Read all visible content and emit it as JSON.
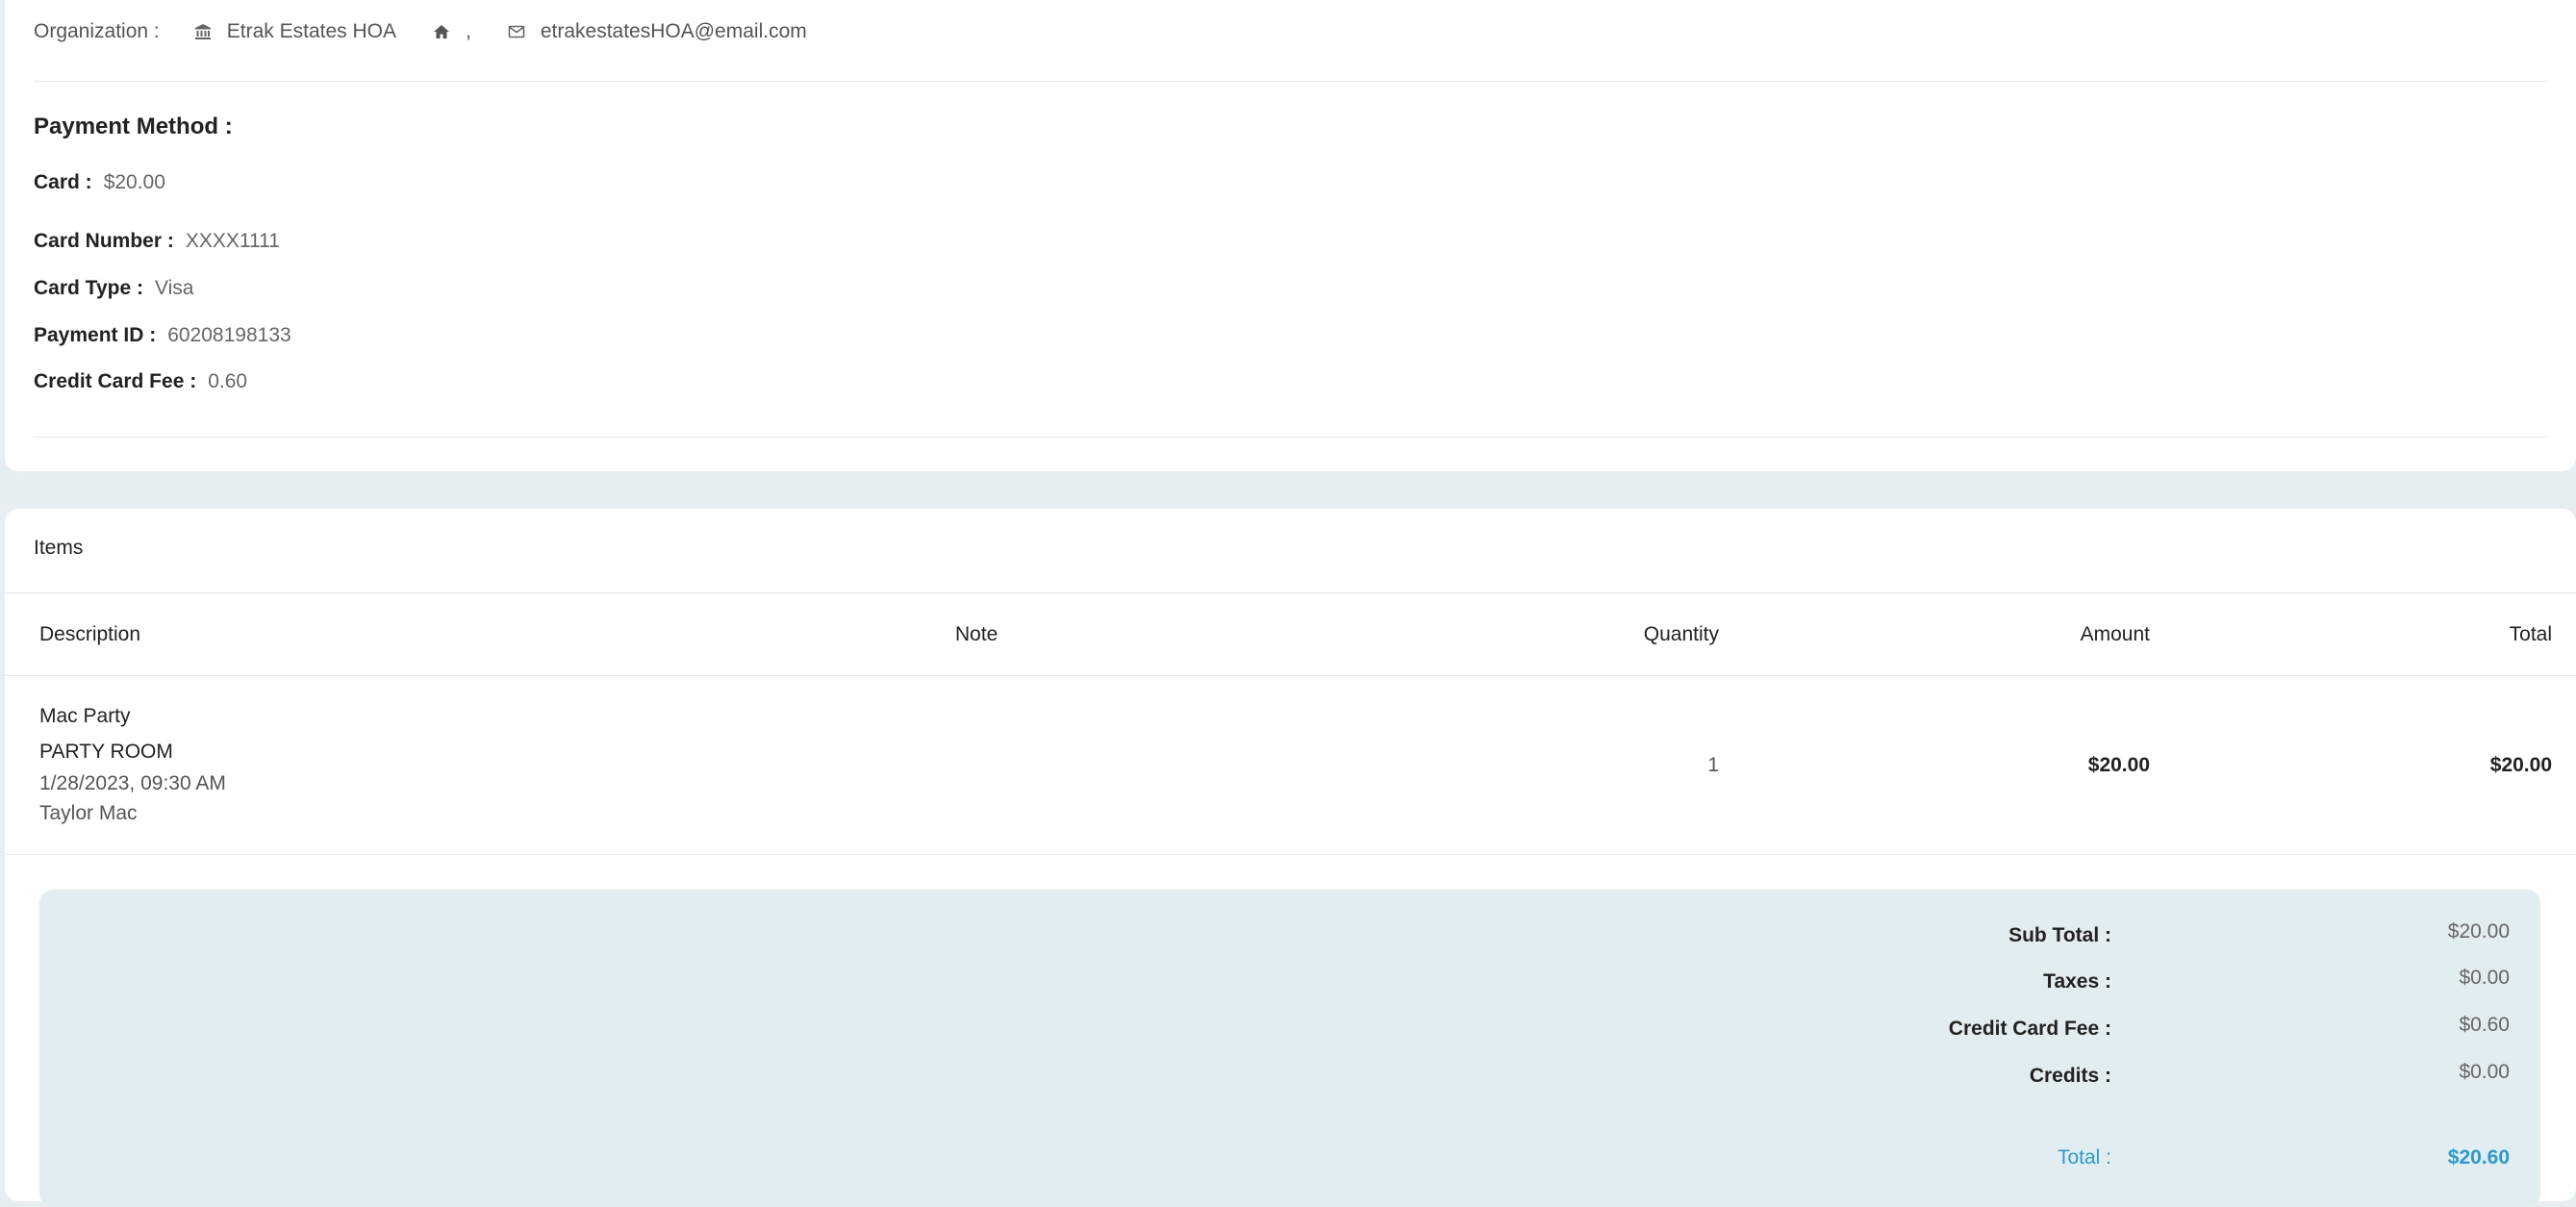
{
  "organization": {
    "label": "Organization :",
    "name": "Etrak Estates HOA",
    "address": ",",
    "email": "etrakestatesHOA@email.com",
    "icons": [
      "bank-icon",
      "home-icon",
      "mail-icon"
    ]
  },
  "payment_method": {
    "title": "Payment Method :",
    "card_label": "Card :",
    "card_value": "$20.00",
    "card_number_label": "Card Number :",
    "card_number_value": "XXXX1111",
    "card_type_label": "Card Type :",
    "card_type_value": "Visa",
    "payment_id_label": "Payment ID :",
    "payment_id_value": "60208198133",
    "fee_label": "Credit Card Fee :",
    "fee_value": "0.60"
  },
  "items": {
    "title": "Items",
    "columns": [
      "Description",
      "Note",
      "Quantity",
      "Amount",
      "Total"
    ],
    "rows": [
      {
        "name": "Mac Party",
        "room": "PARTY ROOM",
        "datetime": "1/28/2023, 09:30 AM",
        "person": "Taylor Mac",
        "note": "",
        "quantity": "1",
        "amount": "$20.00",
        "total": "$20.00"
      }
    ]
  },
  "summary": {
    "subtotal_label": "Sub Total :",
    "subtotal_value": "$20.00",
    "taxes_label": "Taxes :",
    "taxes_value": "$0.00",
    "fee_label": "Credit Card Fee :",
    "fee_value": "$0.60",
    "credits_label": "Credits :",
    "credits_value": "$0.00",
    "total_label": "Total :",
    "total_value": "$20.60"
  },
  "colors": {
    "background": "#e6eef1",
    "summary_bg": "#e2edf1",
    "accent_total": "#2a9bd0"
  }
}
